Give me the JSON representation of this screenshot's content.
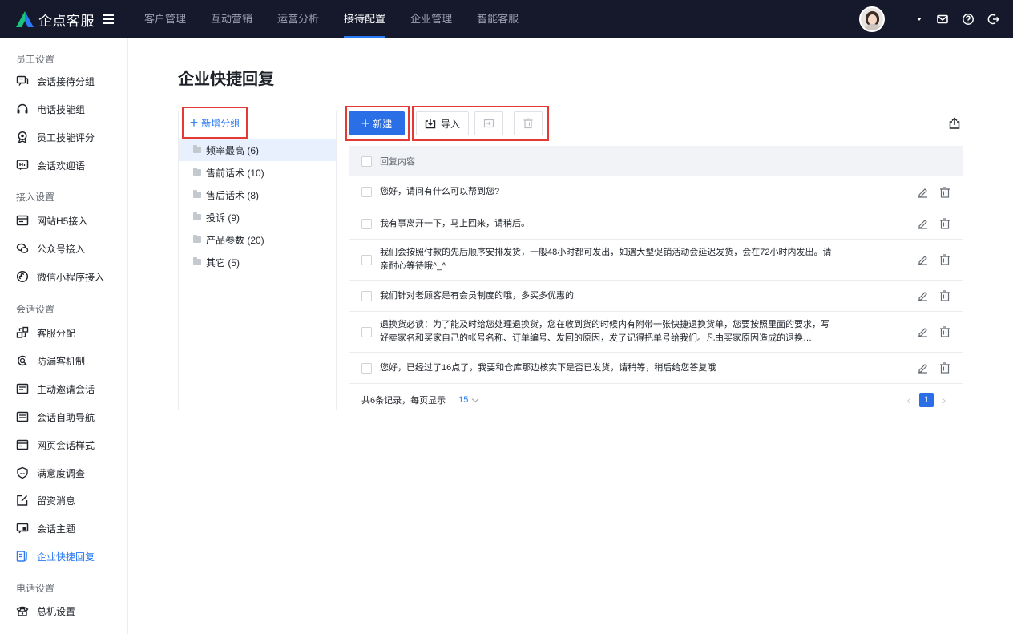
{
  "brand": {
    "name": "企点客服"
  },
  "nav": [
    {
      "label": "客户管理"
    },
    {
      "label": "互动营销"
    },
    {
      "label": "运营分析"
    },
    {
      "label": "接待配置",
      "active": true
    },
    {
      "label": "企业管理"
    },
    {
      "label": "智能客服"
    }
  ],
  "sidebar": {
    "groups": [
      {
        "title": "员工设置",
        "items": [
          "会话接待分组",
          "电话技能组",
          "员工技能评分",
          "会话欢迎语"
        ]
      },
      {
        "title": "接入设置",
        "items": [
          "网站H5接入",
          "公众号接入",
          "微信小程序接入"
        ]
      },
      {
        "title": "会话设置",
        "items": [
          "客服分配",
          "防漏客机制",
          "主动邀请会话",
          "会话自助导航",
          "网页会话样式",
          "满意度调查",
          "留资消息",
          "会话主题",
          "企业快捷回复"
        ]
      },
      {
        "title": "电话设置",
        "items": [
          "总机设置"
        ]
      }
    ],
    "active_item": "企业快捷回复"
  },
  "page": {
    "title": "企业快捷回复"
  },
  "group_panel": {
    "add_label": "新增分组",
    "items": [
      "频率最高 (6)",
      "售前话术 (10)",
      "售后话术 (8)",
      "投诉 (9)",
      "产品参数 (20)",
      "其它 (5)"
    ]
  },
  "toolbar": {
    "new_label": "新建",
    "import_label": "导入"
  },
  "table": {
    "header": "回复内容",
    "rows": [
      "您好，请问有什么可以帮到您?",
      "我有事离开一下，马上回来，请稍后。",
      "我们会按照付款的先后顺序安排发货，一般48小时都可发出，如遇大型促销活动会延迟发货，会在72小时内发出。请亲耐心等待哦^_^",
      "我们针对老顾客是有会员制度的哦，多买多优惠的",
      "退换货必读：为了能及时给您处理退换货，您在收到货的时候内有附带一张快捷退换货单，您要按照里面的要求，写好卖家名和买家自己的帐号名称、订单编号、发回的原因，发了记得把单号给我们。凡由买家原因造成的退换…",
      "您好，已经过了16点了，我要和仓库那边核实下是否已发货，请稍等，稍后给您答复哦"
    ]
  },
  "footer": {
    "summary": "共6条记录，每页显示",
    "page_size": "15",
    "current_page": "1"
  },
  "colors": {
    "accent": "#2b6fe6",
    "topbar": "#15192b",
    "highlight": "#e53935"
  }
}
